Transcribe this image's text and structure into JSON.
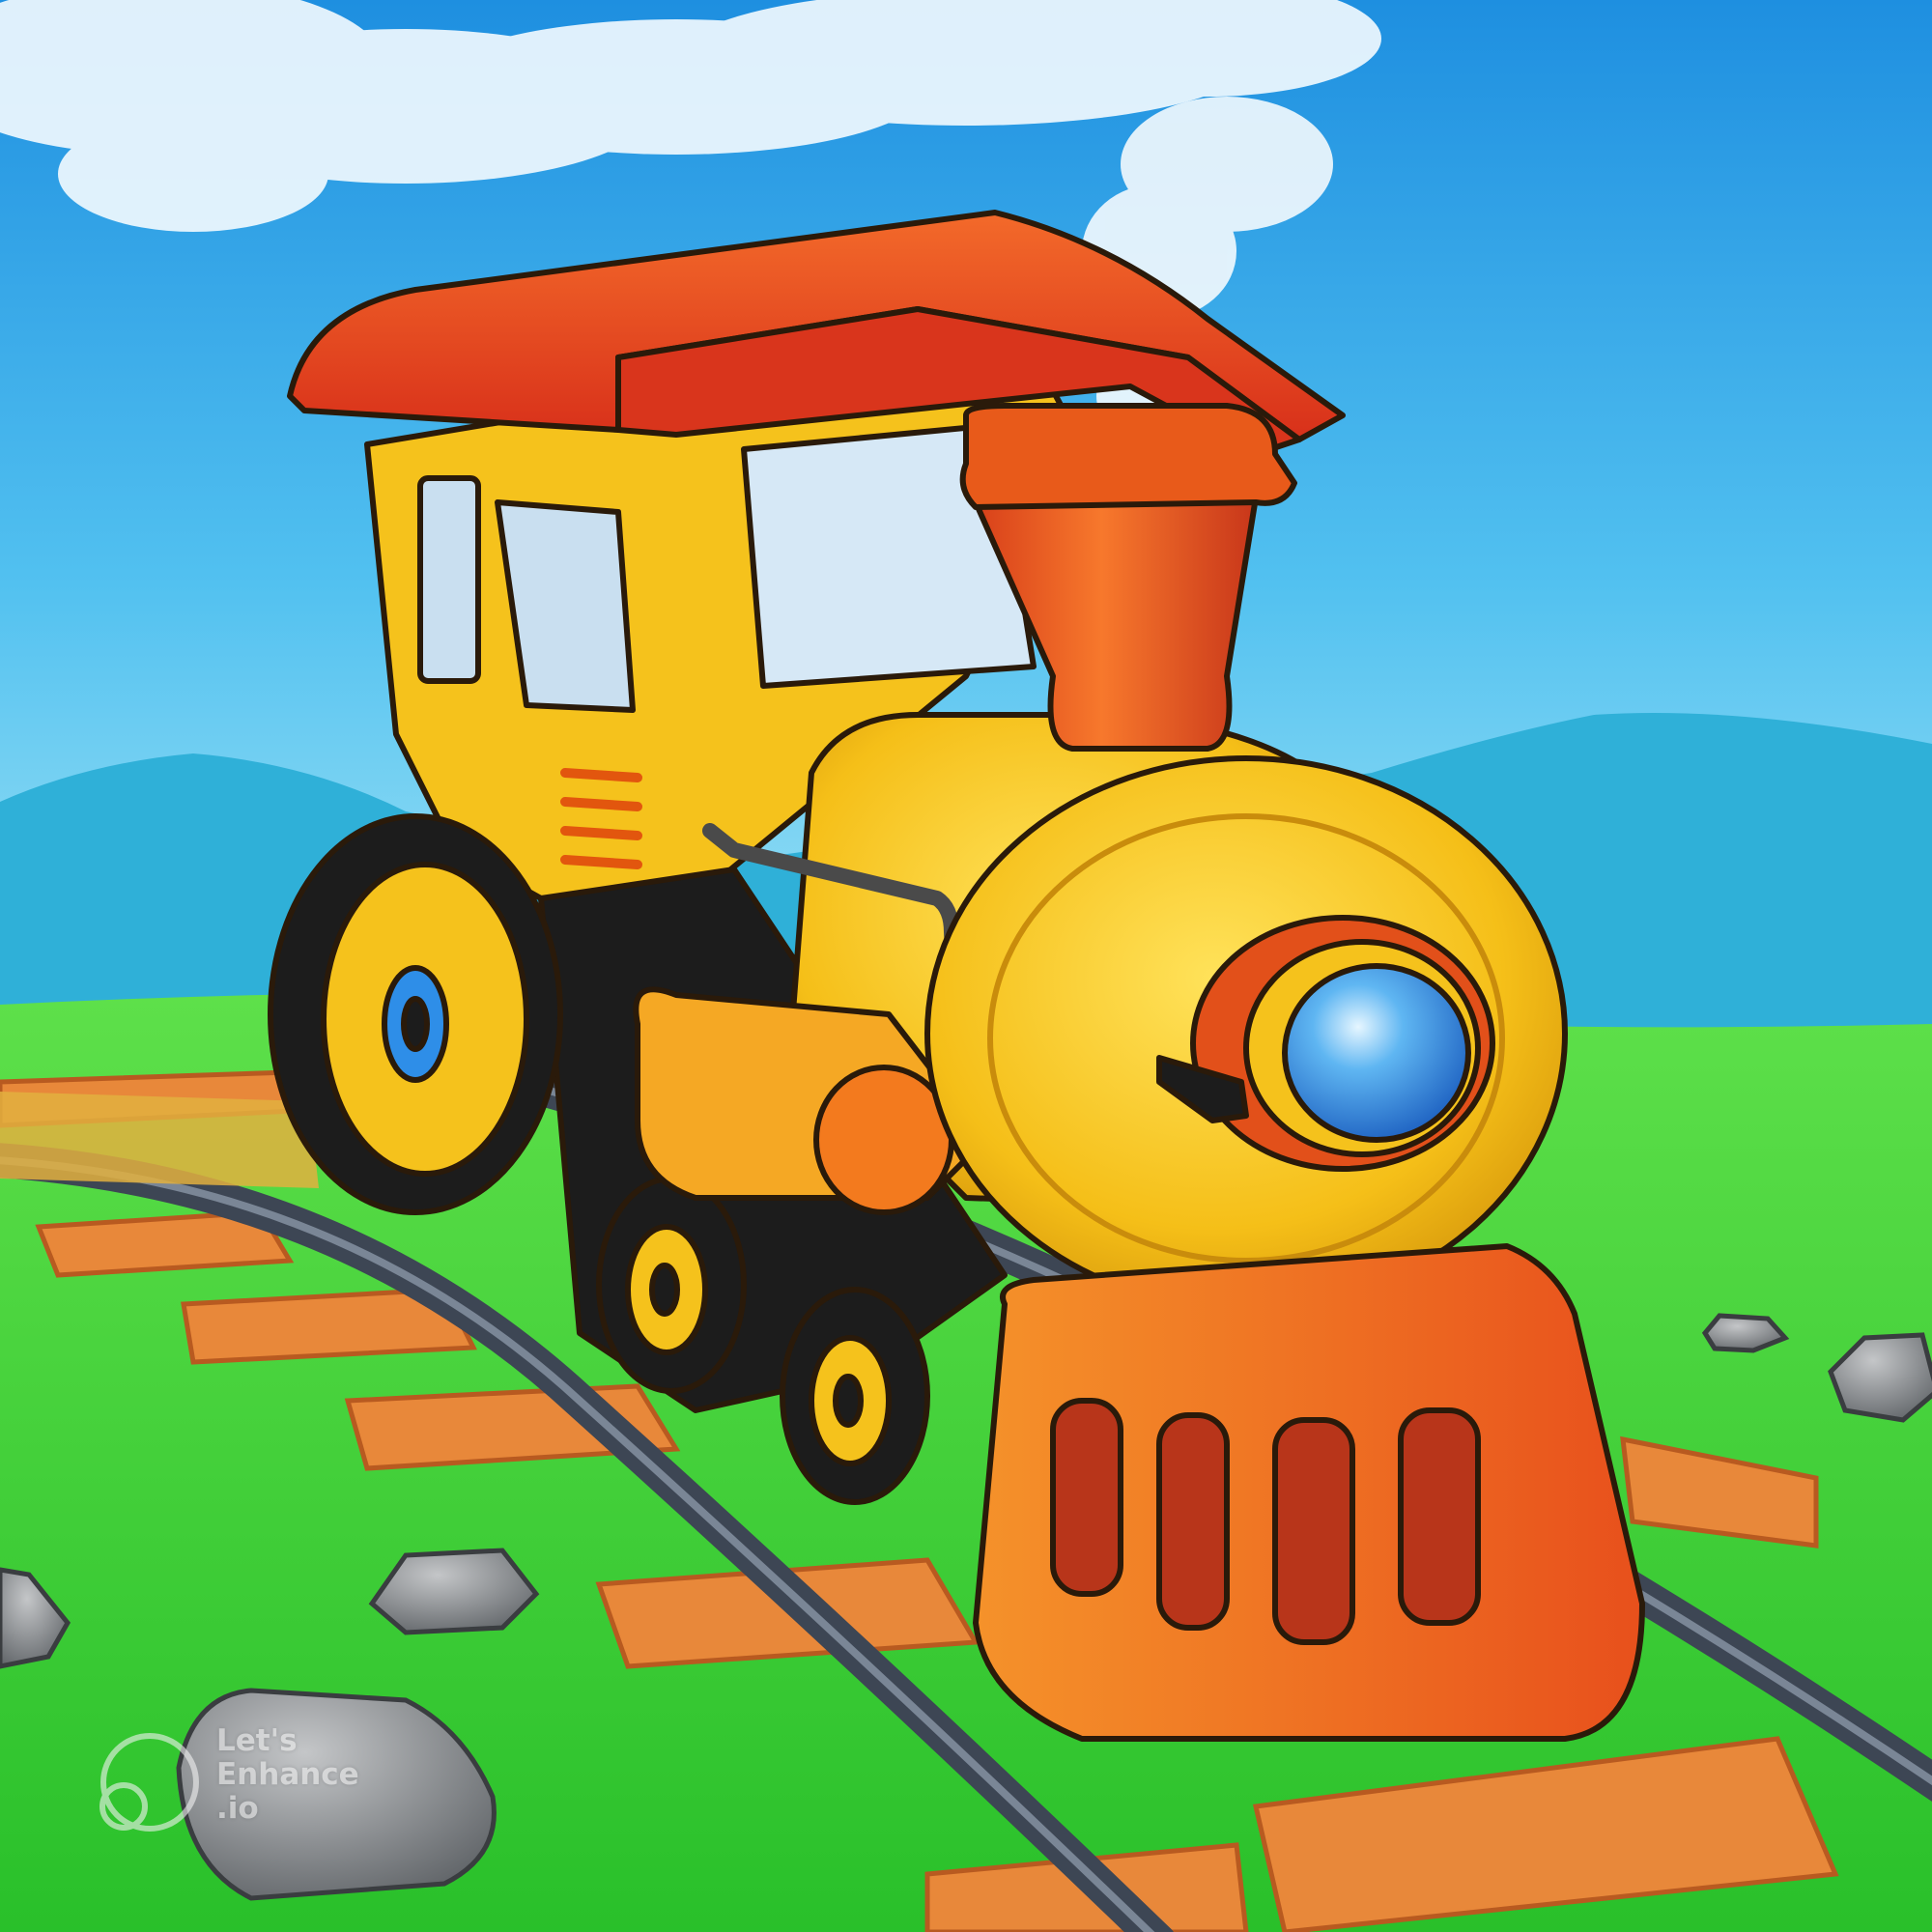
{
  "image": {
    "subject": "yellow-and-red cartoon steam locomotive on a curved railway track",
    "colors": {
      "sky_top": "#1e8fe0",
      "sky_bottom": "#7fd8f2",
      "hills": "#2fb0d8",
      "grass": "#3fcf3a",
      "train_body": "#f5c21c",
      "roof": "#e8401c",
      "chimney": "#e85a1a",
      "cowcatcher": "#f07a1c",
      "headlight": "#2e8ee8",
      "rail": "#3d4654",
      "sleeper": "#e8883a",
      "wheel": "#1c1c1c",
      "rock": "#8a8d90"
    }
  },
  "watermark": {
    "text": "Let's\nEnhance\n.io",
    "icon": "lets-enhance-logo-icon"
  }
}
